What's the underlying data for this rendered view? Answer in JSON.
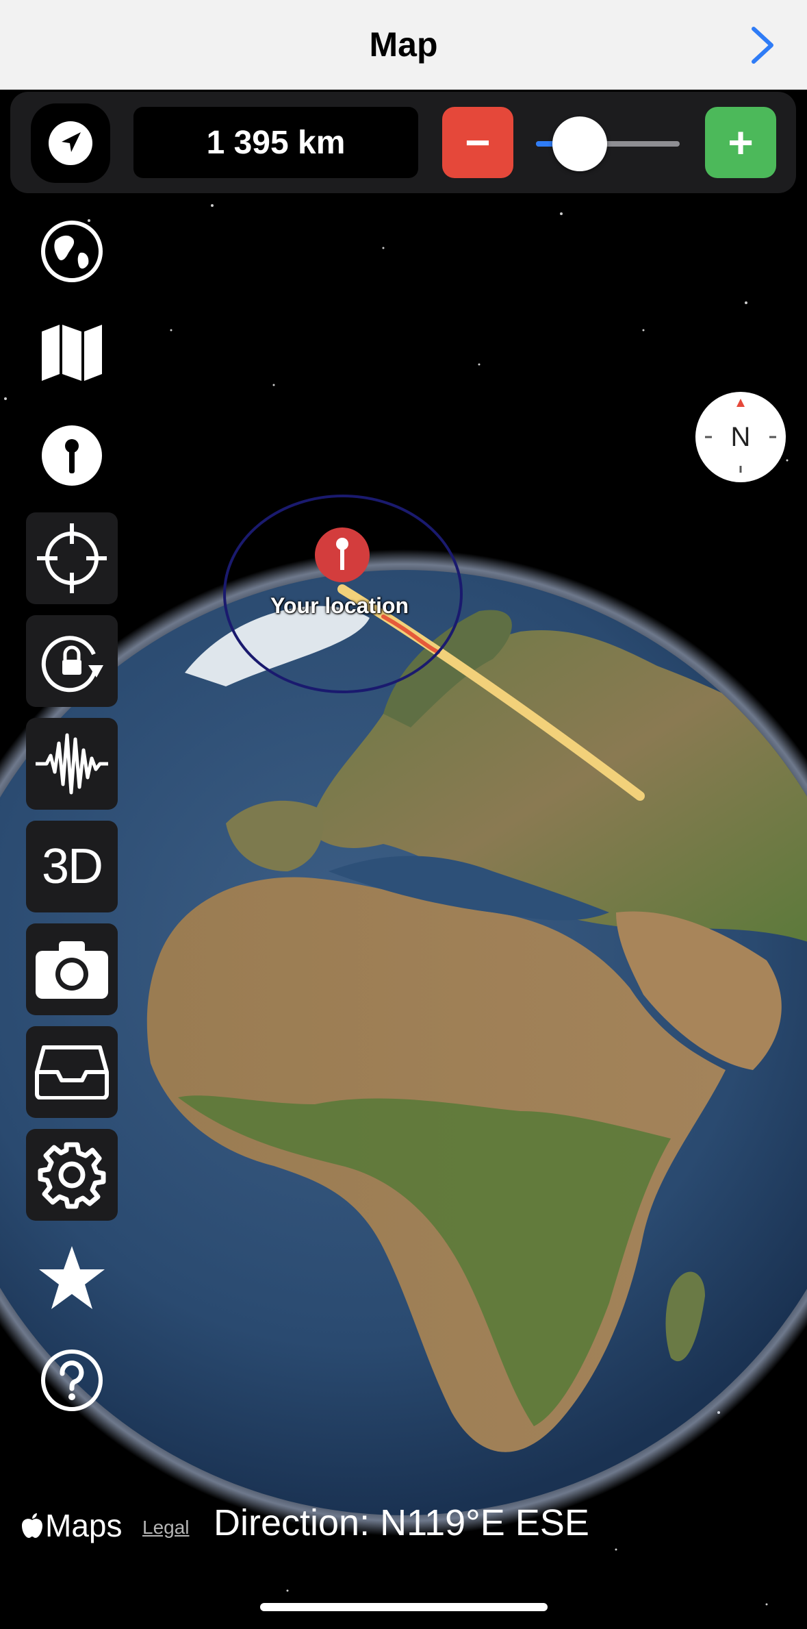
{
  "header": {
    "title": "Map",
    "forward_icon": "chevron-right-icon"
  },
  "toolbar": {
    "locate_icon": "location-arrow-icon",
    "distance": "1 395 km",
    "zoom_out_label": "−",
    "zoom_in_label": "+",
    "zoom_slider_fraction": 0.08
  },
  "compass": {
    "label": "N"
  },
  "sidebar": {
    "items": [
      {
        "name": "globe-icon"
      },
      {
        "name": "map-icon"
      },
      {
        "name": "pin-icon"
      },
      {
        "name": "crosshair-icon"
      },
      {
        "name": "rotation-lock-icon"
      },
      {
        "name": "waveform-icon"
      },
      {
        "name": "3d-button",
        "label": "3D"
      },
      {
        "name": "camera-icon"
      },
      {
        "name": "tray-icon"
      },
      {
        "name": "gear-icon"
      },
      {
        "name": "star-icon"
      },
      {
        "name": "help-icon"
      }
    ]
  },
  "map": {
    "marker_label": "Your location"
  },
  "footer": {
    "maps_label": "Maps",
    "legal_label": "Legal",
    "direction": "Direction: N119°E  ESE"
  },
  "colors": {
    "zoom_out": "#e5483a",
    "zoom_in": "#4cb95a",
    "slider_fill": "#2f7cf6",
    "accent": "#2f7cf6"
  }
}
